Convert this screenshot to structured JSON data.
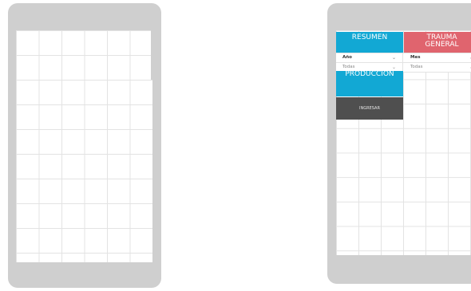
{
  "left_phone": {},
  "right_phone": {
    "tiles": {
      "resumen_label": "RESUMEN",
      "trauma_line1": "TRAUMA",
      "trauma_line2": "GENERAL",
      "produccion_label": "PRODUCCION"
    },
    "filters": {
      "year_label": "Año",
      "year_value": "Todas",
      "month_label": "Mes",
      "month_value": "Todas",
      "chevron_icon": "chevron-down-icon"
    },
    "ingresar_button_label": "INGRESAR",
    "colors": {
      "resumen": "#12a8d4",
      "trauma": "#e0646e",
      "ingresar": "#4f4f4f",
      "frame": "#cfcfcf"
    }
  }
}
